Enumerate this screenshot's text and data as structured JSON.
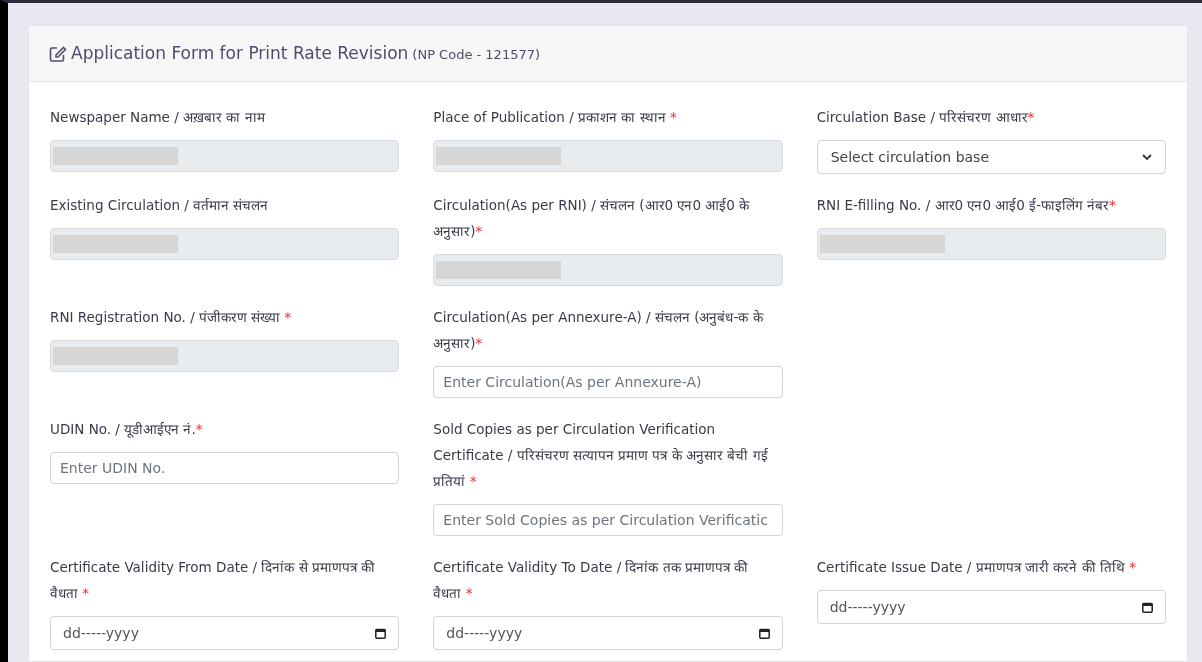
{
  "card": {
    "title": "Application Form for Print Rate Revision",
    "subtitle": "(NP Code - 121577)"
  },
  "rows": [
    [
      {
        "kind": "readonly",
        "label": "Newspaper Name / अख़बार का नाम",
        "redacted": true
      },
      {
        "kind": "readonly",
        "label": "Place of Publication / प्रकाशन का स्थान ",
        "required_mark": "*",
        "redacted": true
      },
      {
        "kind": "select",
        "label": "Circulation Base / परिसंचरण आधार",
        "required_mark": "*",
        "value": "Select circulation base"
      }
    ],
    [
      {
        "kind": "readonly",
        "label": "Existing Circulation / वर्तमान संचलन",
        "redacted": true
      },
      {
        "kind": "readonly",
        "label": "Circulation(As per RNI) / संचलन (आर0 एन0 आई0 के अनुसार)",
        "required_mark": "*",
        "redacted": true
      },
      {
        "kind": "readonly",
        "label": "RNI E-filling No. / आर0 एन0 आई0 ई-फाइलिंग नंबर",
        "required_mark": "*",
        "redacted": true
      }
    ],
    [
      {
        "kind": "readonly",
        "label": "RNI Registration No. / पंजीकरण संख्या ",
        "required_mark": "*",
        "redacted": true
      },
      {
        "kind": "text",
        "label": "Circulation(As per Annexure-A) / संचलन (अनुबंध-क के अनुसार)",
        "required_mark": "*",
        "placeholder": "Enter Circulation(As per Annexure-A)"
      }
    ],
    [
      {
        "kind": "text",
        "label": "UDIN No. / यूडीआईएन नं.",
        "required_mark": "*",
        "placeholder": "Enter UDIN No."
      },
      {
        "kind": "text",
        "label": "Sold Copies as per Circulation Verification Certificate / परिसंचरण सत्यापन प्रमाण पत्र के अनुसार बेची गई प्रतियां ",
        "required_mark": "*",
        "placeholder": "Enter Sold Copies as per Circulation Verificatic"
      }
    ],
    [
      {
        "kind": "date",
        "label": "Certificate Validity From Date / दिनांक से प्रमाणपत्र की वैधता ",
        "required_mark": "*",
        "placeholder": "dd-----yyyy"
      },
      {
        "kind": "date",
        "label": "Certificate Validity To Date / दिनांक तक प्रमाणपत्र की वैधता ",
        "required_mark": "*",
        "placeholder": "dd-----yyyy"
      },
      {
        "kind": "date",
        "label": "Certificate Issue Date / प्रमाणपत्र जारी करने की तिथि ",
        "required_mark": "*",
        "placeholder": "dd-----yyyy"
      }
    ]
  ]
}
